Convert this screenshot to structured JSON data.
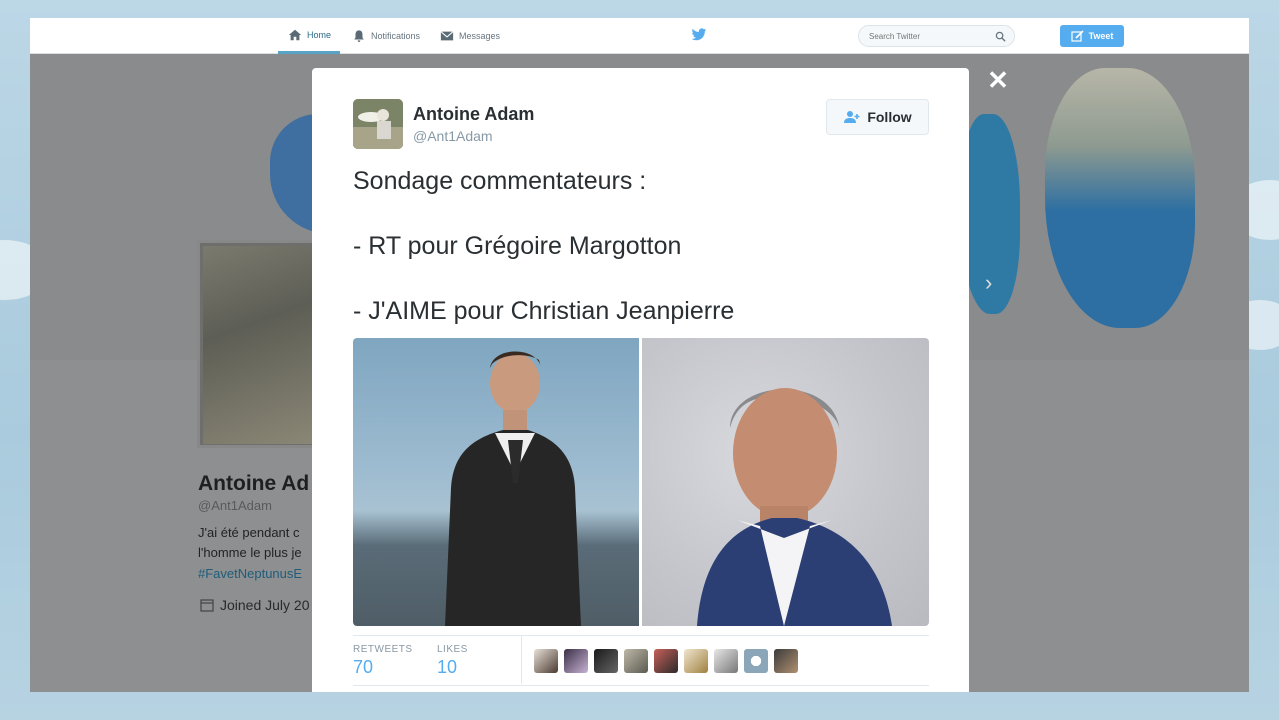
{
  "nav": {
    "home_label": "Home",
    "notifications_label": "Notifications",
    "messages_label": "Messages",
    "search_placeholder": "Search Twitter",
    "tweet_button_label": "Tweet"
  },
  "background_profile": {
    "name": "Antoine Ad",
    "handle": "@Ant1Adam",
    "bio_lines": [
      "J'ai été pendant c",
      "l'homme le plus je"
    ],
    "hashtag": "#FavetNeptunusE",
    "joined": "Joined July 20"
  },
  "modal": {
    "close_label": "✕",
    "author": {
      "name": "Antoine Adam",
      "handle": "@Ant1Adam"
    },
    "follow_label": "Follow",
    "tweet_lines": [
      "Sondage commentateurs :",
      "- RT pour Grégoire Margotton",
      "- J'AIME pour Christian Jeanpierre"
    ],
    "stats": {
      "retweets_label": "RETWEETS",
      "retweets_value": "70",
      "likes_label": "LIKES",
      "likes_value": "10"
    }
  },
  "colors": {
    "twitter_blue": "#55acee",
    "text_dark": "#292f33",
    "text_muted": "#8899a6"
  },
  "icons": [
    "home-icon",
    "bell-icon",
    "envelope-icon",
    "twitter-bird-icon",
    "search-icon",
    "compose-icon",
    "close-icon",
    "add-user-icon",
    "calendar-icon",
    "chevron-left-icon",
    "chevron-right-icon"
  ]
}
